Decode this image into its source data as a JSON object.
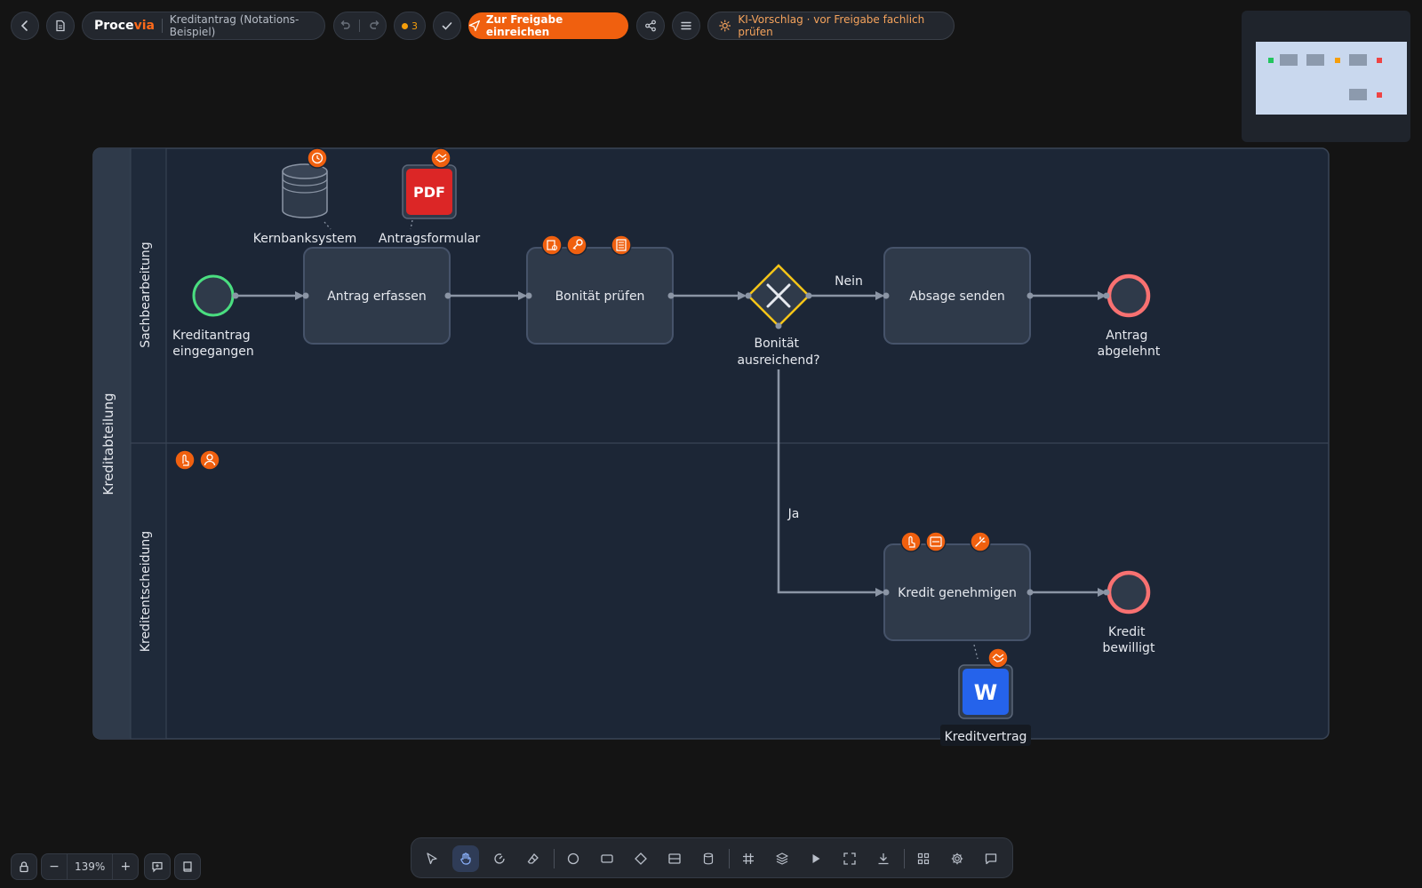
{
  "header": {
    "brand_main": "Proce",
    "brand_accent": "via",
    "document_title": "Kreditantrag (Notations-Beispiel)",
    "issue_count": "3",
    "submit_label": "Zur Freigabe einreichen",
    "ai_hint": "KI-Vorschlag · vor Freigabe fachlich prüfen"
  },
  "pool": {
    "name": "Kreditabteilung",
    "lanes": [
      "Sachbearbeitung",
      "Kreditentscheidung"
    ]
  },
  "diagram": {
    "start_event": "Kreditantrag\neingegangen",
    "tasks": {
      "capture": "Antrag erfassen",
      "check": "Bonität prüfen",
      "reject": "Absage senden",
      "approve": "Kredit genehmigen"
    },
    "gateway": "Bonität\nausreichend?",
    "flow_labels": {
      "no": "Nein",
      "yes": "Ja"
    },
    "end_events": {
      "rejected": "Antrag\nabgelehnt",
      "approved": "Kredit\nbewilligt"
    },
    "artifacts": {
      "database": "Kernbanksystem",
      "form": "Antragsformular",
      "form_badge": "PDF",
      "contract": "Kreditvertrag",
      "contract_badge": "W"
    }
  },
  "zoom": {
    "level": "139%"
  },
  "colors": {
    "accent": "#f0600f",
    "start_event": "#4ade80",
    "end_event": "#f87171",
    "gateway": "#f5c518",
    "task_fill": "#2f3a4a",
    "lane_fill": "#1c2636"
  }
}
